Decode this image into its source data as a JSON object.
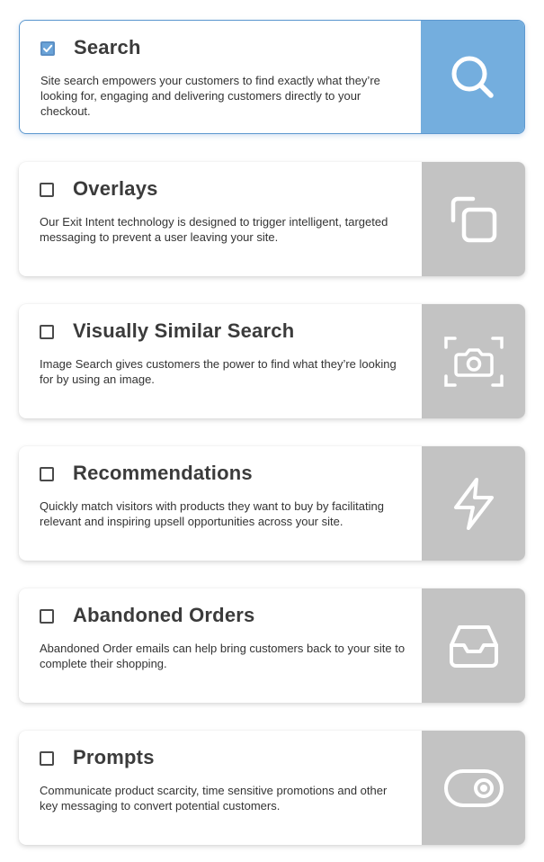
{
  "features": [
    {
      "title": "Search",
      "description": "Site search empowers your customers to find exactly what they’re looking for, engaging and delivering customers directly to your checkout.",
      "checked": true,
      "icon": "search-icon"
    },
    {
      "title": "Overlays",
      "description": "Our Exit Intent technology is designed to trigger intelligent, targeted messaging to prevent a user leaving your site.",
      "checked": false,
      "icon": "overlay-icon"
    },
    {
      "title": "Visually Similar Search",
      "description": "Image Search gives customers the power to find what they’re looking for by using an image.",
      "checked": false,
      "icon": "camera-scan-icon"
    },
    {
      "title": "Recommendations",
      "description": "Quickly match visitors with products they want to buy by facilitating relevant and inspiring upsell opportunities across your site.",
      "checked": false,
      "icon": "lightning-icon"
    },
    {
      "title": "Abandoned Orders",
      "description": "Abandoned Order emails can help bring customers back to your site to complete their shopping.",
      "checked": false,
      "icon": "inbox-tray-icon"
    },
    {
      "title": "Prompts",
      "description": "Communicate product scarcity, time sensitive promotions and other key messaging to convert potential customers.",
      "checked": false,
      "icon": "toggle-icon"
    }
  ],
  "colors": {
    "selected_panel": "#74aede",
    "selected_border": "#5c98cf",
    "unselected_panel": "#c3c3c3",
    "title_text": "#3b3b3b",
    "body_text": "#333333"
  }
}
